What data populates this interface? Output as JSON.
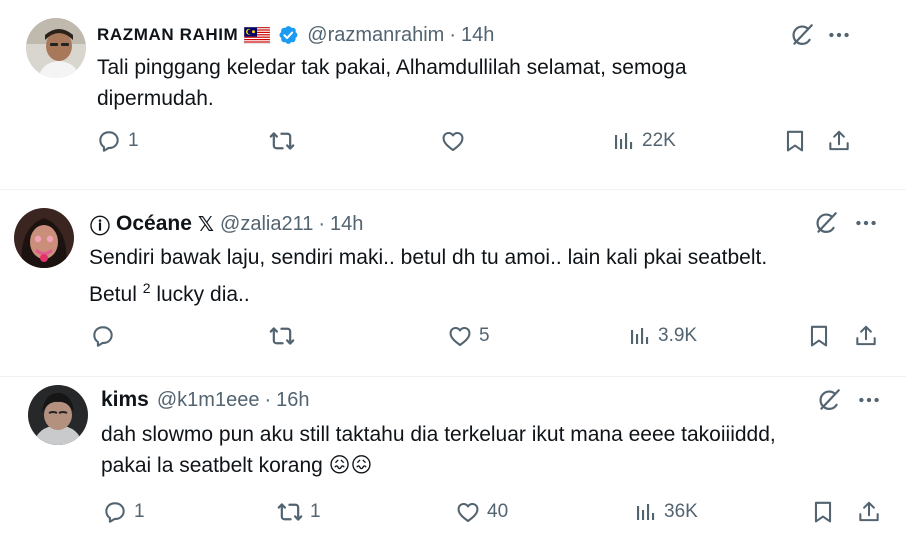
{
  "tweets": [
    {
      "name": "RAZMAN RAHIM",
      "flag": "🇲🇾",
      "handle": "@razmanrahim",
      "dot": "·",
      "time": "14h",
      "line1": "Tali pinggang keledar tak pakai, Alhamdullilah selamat, semoga",
      "line2": "dipermudah.",
      "replies": "1",
      "retweets": "",
      "likes": "",
      "views": "22K",
      "verified": true
    },
    {
      "prefix_icon": "ⓘ",
      "name": "Océane",
      "name_suffix": "𝕏",
      "handle": "@zalia211",
      "dot": "·",
      "time": "14h",
      "line1": "Sendiri bawak laju, sendiri maki.. betul dh tu amoi.. lain kali pkai seatbelt.",
      "line2_a": "Betul ",
      "line2_sup": "2",
      "line2_b": " lucky dia..",
      "replies": "",
      "retweets": "",
      "likes": "5",
      "views": "3.9K"
    },
    {
      "name": "kims",
      "handle": "@k1m1eee",
      "dot": "·",
      "time": "16h",
      "line1": "dah slowmo pun aku still taktahu dia terkeluar ikut mana eeee takoiiiddd,",
      "line2": "pakai la seatbelt korang 😖😖",
      "replies": "1",
      "retweets": "1",
      "likes": "40",
      "views": "36K"
    }
  ],
  "icons": {
    "reply": "reply-icon",
    "retweet": "retweet-icon",
    "like": "heart-icon",
    "views": "views-icon",
    "bookmark": "bookmark-icon",
    "share": "share-icon",
    "grok": "grok-icon",
    "more": "more-icon"
  },
  "colors": {
    "text": "#0f1419",
    "secondary": "#536471",
    "verified": "#1d9bf0"
  }
}
